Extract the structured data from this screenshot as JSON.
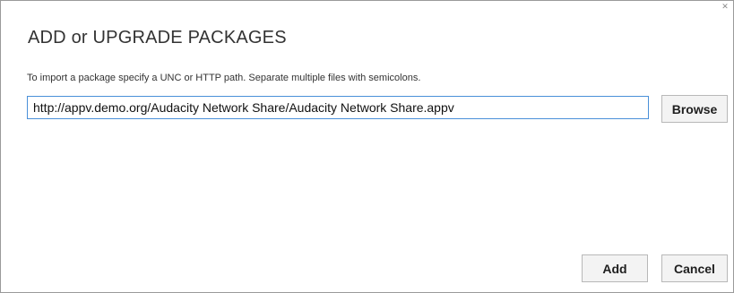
{
  "dialog": {
    "close_glyph": "✕",
    "title": "ADD or UPGRADE PACKAGES",
    "instructions": "To import a package specify a UNC or HTTP path. Separate multiple files with semicolons.",
    "path_input": {
      "value": "http://appv.demo.org/Audacity Network Share/Audacity Network Share.appv"
    },
    "buttons": {
      "browse_label": "Browse",
      "add_label": "Add",
      "cancel_label": "Cancel"
    }
  },
  "colors": {
    "input_focus_border": "#4a90d9",
    "button_background": "#f3f3f3",
    "dialog_border": "#9a9a9a"
  }
}
